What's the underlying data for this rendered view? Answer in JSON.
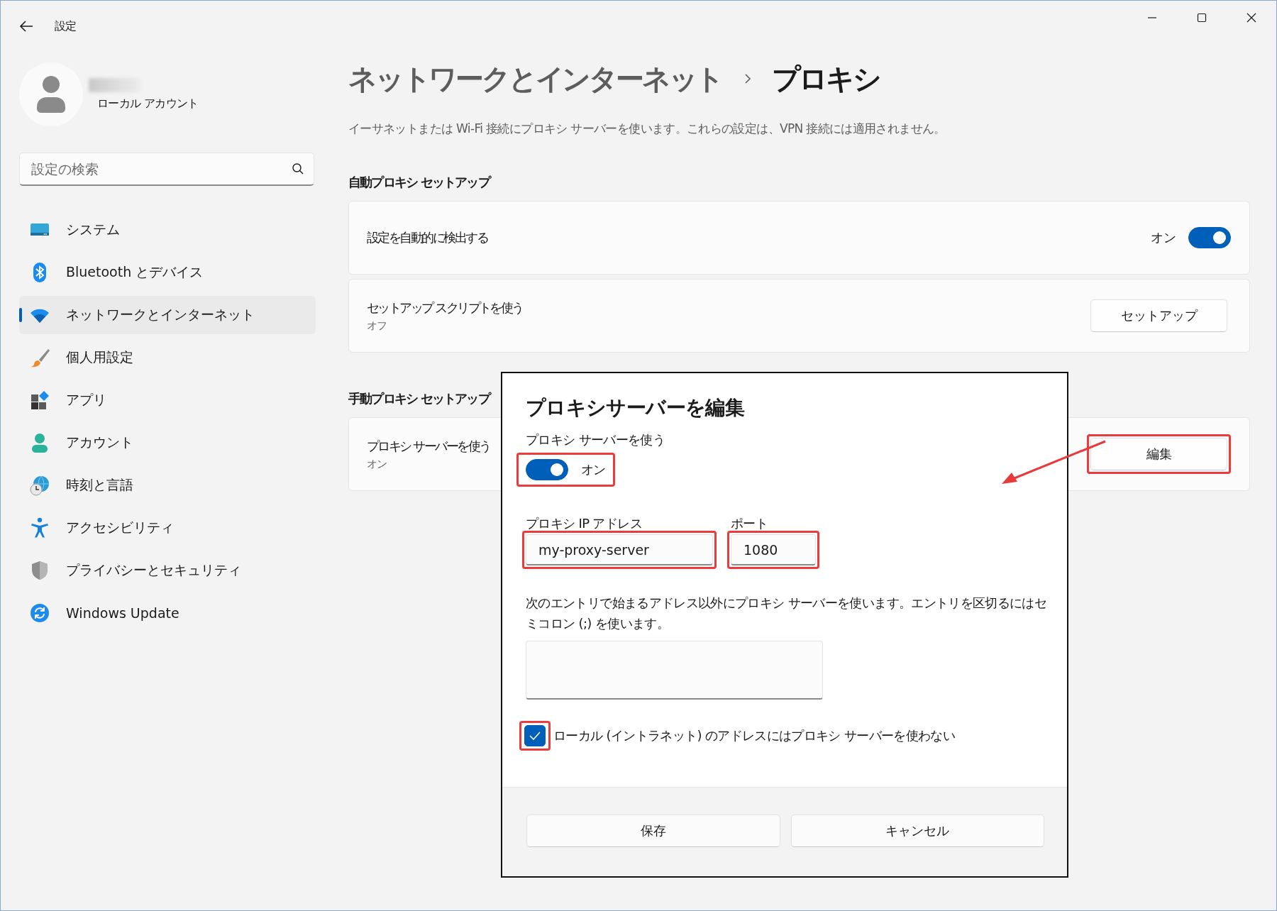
{
  "window": {
    "title": "設定"
  },
  "account": {
    "type": "ローカル アカウント"
  },
  "search": {
    "placeholder": "設定の検索"
  },
  "sidebar": {
    "items": [
      {
        "label": "システム",
        "selected": false
      },
      {
        "label": "Bluetooth とデバイス",
        "selected": false
      },
      {
        "label": "ネットワークとインターネット",
        "selected": true
      },
      {
        "label": "個人用設定",
        "selected": false
      },
      {
        "label": "アプリ",
        "selected": false
      },
      {
        "label": "アカウント",
        "selected": false
      },
      {
        "label": "時刻と言語",
        "selected": false
      },
      {
        "label": "アクセシビリティ",
        "selected": false
      },
      {
        "label": "プライバシーとセキュリティ",
        "selected": false
      },
      {
        "label": "Windows Update",
        "selected": false
      }
    ]
  },
  "breadcrumb": {
    "parent": "ネットワークとインターネット",
    "current": "プロキシ"
  },
  "description": "イーサネットまたは Wi-Fi 接続にプロキシ サーバーを使います。これらの設定は、VPN 接続には適用されません。",
  "sections": [
    {
      "title": "自動プロキシ セットアップ",
      "rows": [
        {
          "kind": "toggle",
          "label": "設定を自動的に検出する",
          "state_text": "オン",
          "on": true
        },
        {
          "kind": "button",
          "label": "セットアップ スクリプトを使う",
          "sublabel": "オフ",
          "button": "セットアップ",
          "highlighted": false
        }
      ]
    },
    {
      "title": "手動プロキシ セットアップ",
      "rows": [
        {
          "kind": "button",
          "label": "プロキシ サーバーを使う",
          "sublabel": "オン",
          "button": "編集",
          "highlighted": true
        }
      ]
    }
  ],
  "dialog": {
    "title": "プロキシサーバーを編集",
    "toggle": {
      "label": "プロキシ サーバーを使う",
      "state_text": "オン",
      "on": true,
      "highlighted": true
    },
    "ip": {
      "label": "プロキシ IP アドレス",
      "value": "my-proxy-server",
      "highlighted": true
    },
    "port": {
      "label": "ポート",
      "value": "1080",
      "highlighted": true
    },
    "exceptions": {
      "label": "次のエントリで始まるアドレス以外にプロキシ サーバーを使います。エントリを区切るにはセミコロン (;) を使います。"
    },
    "local_checkbox": {
      "label": "ローカル (イントラネット) のアドレスにはプロキシ サーバーを使わない",
      "checked": true,
      "highlighted": true
    },
    "buttons": [
      "保存",
      "キャンセル"
    ]
  }
}
